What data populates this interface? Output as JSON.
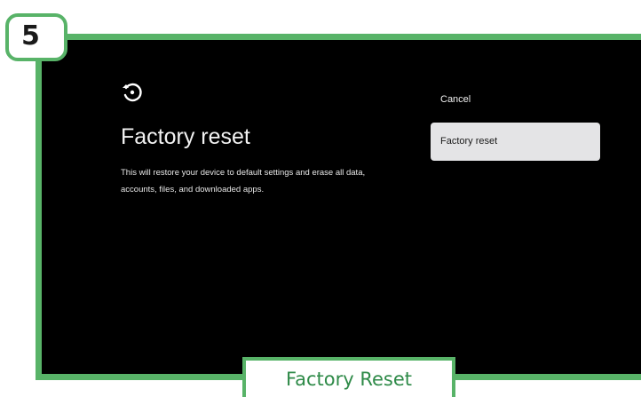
{
  "step_badge": {
    "number": "5"
  },
  "screen": {
    "icon": "restore-icon",
    "title": "Factory reset",
    "description": "This will restore your device to default settings and erase all data, accounts, files, and downloaded apps.",
    "options": [
      {
        "label": "Cancel",
        "selected": false
      },
      {
        "label": "Factory reset",
        "selected": true
      }
    ]
  },
  "caption": {
    "text": "Factory Reset"
  },
  "colors": {
    "frame": "#58b368",
    "screen_bg": "#000000",
    "selected_option_bg": "#e4e4e6",
    "caption_text": "#2e8a48"
  }
}
